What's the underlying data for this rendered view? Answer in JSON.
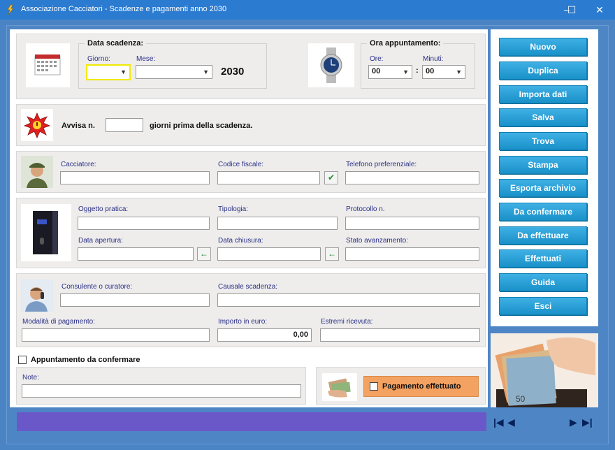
{
  "window": {
    "title": "Associazione Cacciatori - Scadenze e pagamenti anno 2030",
    "minimize": "–",
    "maximize": "☐",
    "close": "✕"
  },
  "scadenza": {
    "legend": "Data scadenza:",
    "giorno_label": "Giorno:",
    "giorno_value": "",
    "mese_label": "Mese:",
    "mese_value": "",
    "anno": "2030"
  },
  "appuntamento": {
    "legend": "Ora appuntamento:",
    "ore_label": "Ore:",
    "ore_value": "00",
    "minuti_label": "Minuti:",
    "minuti_value": "00",
    "separator": ":"
  },
  "avviso": {
    "prefix": "Avvisa n.",
    "value": "",
    "suffix": "giorni prima della scadenza."
  },
  "cacciatore": {
    "nome_label": "Cacciatore:",
    "nome_value": "",
    "cf_label": "Codice fiscale:",
    "cf_value": "",
    "tel_label": "Telefono preferenziale:",
    "tel_value": ""
  },
  "pratica": {
    "oggetto_label": "Oggetto pratica:",
    "oggetto_value": "",
    "tipologia_label": "Tipologia:",
    "tipologia_value": "",
    "protocollo_label": "Protocollo n.",
    "protocollo_value": "",
    "apertura_label": "Data apertura:",
    "apertura_value": "",
    "chiusura_label": "Data chiusura:",
    "chiusura_value": "",
    "stato_label": "Stato avanzamento:",
    "stato_value": ""
  },
  "consulente": {
    "nome_label": "Consulente o curatore:",
    "nome_value": "",
    "causale_label": "Causale scadenza:",
    "causale_value": "",
    "modalita_label": "Modalità di pagamento:",
    "modalita_value": "",
    "importo_label": "Importo in euro:",
    "importo_value": "0,00",
    "ricevuta_label": "Estremi ricevuta:",
    "ricevuta_value": ""
  },
  "da_confermare": {
    "label": "Appuntamento da confermare",
    "checked": false
  },
  "note": {
    "label": "Note:",
    "value": ""
  },
  "pagamento": {
    "label": "Pagamento effettuato",
    "checked": false
  },
  "buttons": [
    "Nuovo",
    "Duplica",
    "Importa dati",
    "Salva",
    "Trova",
    "Stampa",
    "Esporta archivio",
    "Da confermare",
    "Da effettuare",
    "Effettuati",
    "Guida",
    "Esci"
  ],
  "colors": {
    "titlebar": "#2b7bd0",
    "background": "#4e86c5",
    "button": "#1991c9",
    "statusbar": "#6a58c9",
    "payment_box": "#f4a261",
    "focus_border": "#f2ea00"
  }
}
